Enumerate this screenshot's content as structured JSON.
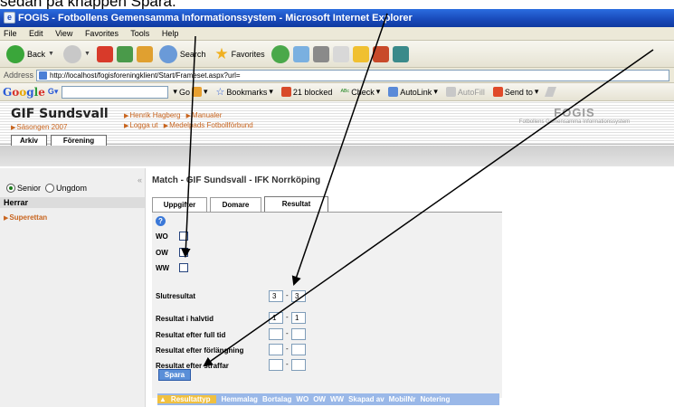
{
  "document": {
    "caption": "sedan på knappen Spara."
  },
  "window": {
    "title": "FOGIS - Fotbollens Gemensamma Informationssystem - Microsoft Internet Explorer",
    "icon": "ie-icon"
  },
  "menubar": {
    "items": [
      "File",
      "Edit",
      "View",
      "Favorites",
      "Tools",
      "Help"
    ]
  },
  "toolbar": {
    "back_label": "Back",
    "search_label": "Search",
    "favorites_label": "Favorites"
  },
  "addressbar": {
    "label": "Address",
    "url": "http://localhost/fogisforeningklient/Start/Frameset.aspx?url="
  },
  "googlebar": {
    "go_label": "Go",
    "bookmarks_label": "Bookmarks",
    "blocked_label": "21 blocked",
    "check_label": "Check",
    "autolink_label": "AutoLink",
    "autofill_label": "AutoFill",
    "sendto_label": "Send to"
  },
  "site": {
    "club_name": "GIF Sundsvall",
    "season": "Säsongen 2007",
    "user_link": "Henrik Hagberg",
    "manual_link": "Manualer",
    "logout_link": "Logga ut",
    "federation_link": "Medelpads Fotbollförbund",
    "brand": "FOGIS",
    "brand_sub": "Fotbollens Gemensamma Informationssystem",
    "top_tabs": [
      "Arkiv",
      "Förening"
    ]
  },
  "sidebar": {
    "radio_senior": "Senior",
    "radio_youth": "Ungdom",
    "selected": "Senior",
    "section": "Herrar",
    "item": "Superettan"
  },
  "main": {
    "match_title": "Match - GIF Sundsvall - IFK Norrköping",
    "tabs": [
      "Uppgifter",
      "Domare",
      "Resultat"
    ],
    "active_tab": "Resultat",
    "checks": [
      "WO",
      "OW",
      "WW"
    ],
    "final_label": "Slutresultat",
    "final_home": "3",
    "final_away": "3",
    "half_label": "Resultat i halvtid",
    "half_home": "1",
    "half_away": "1",
    "fulltime_label": "Resultat efter full tid",
    "extra_label": "Resultat efter förlängning",
    "penalty_label": "Resultat efter straffar",
    "dash": "-",
    "save_label": "Spara",
    "columns": [
      "Resultattyp",
      "Hemmalag",
      "Bortalag",
      "WO",
      "OW",
      "WW",
      "Skapad av",
      "MobilNr",
      "Notering"
    ]
  },
  "colors": {
    "orange_link": "#c8641e",
    "titlebar_blue": "#1848b8",
    "table_header": "#9ab8e8",
    "save_button": "#5a8fd8"
  }
}
